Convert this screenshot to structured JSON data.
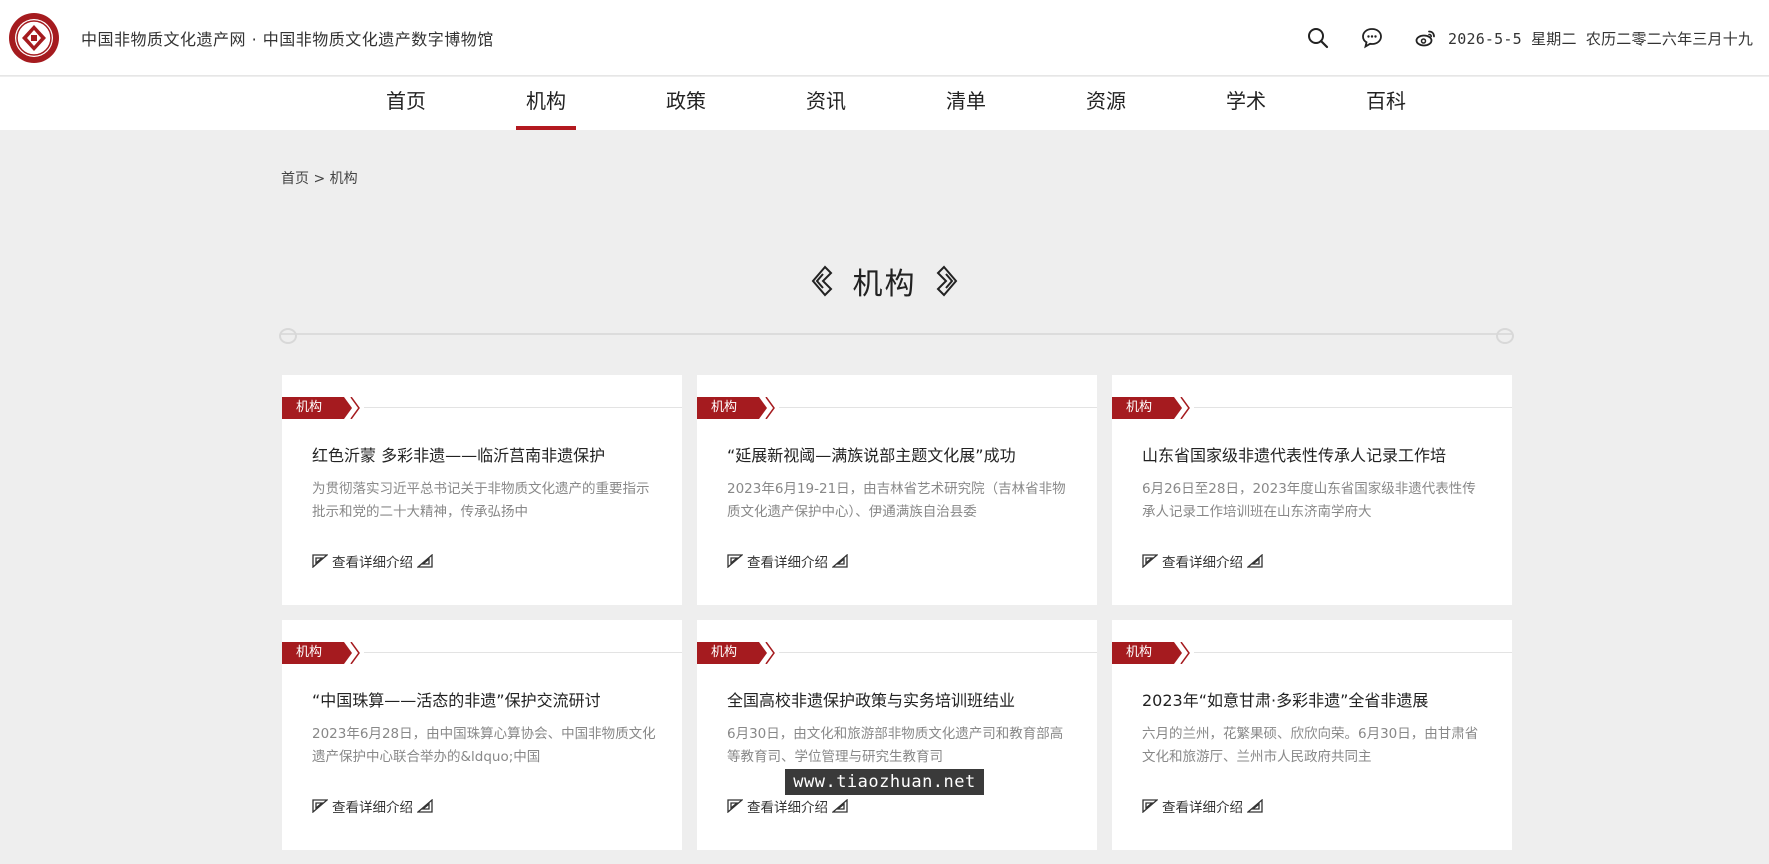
{
  "header": {
    "site_title": "中国非物质文化遗产网 · 中国非物质文化遗产数字博物馆",
    "date": "2026-5-5 星期二 农历二零二六年三月十九",
    "icons": [
      "search-icon",
      "chat-icon",
      "weibo-icon"
    ]
  },
  "nav": {
    "items": [
      "首页",
      "机构",
      "政策",
      "资讯",
      "清单",
      "资源",
      "学术",
      "百科"
    ],
    "active": "机构"
  },
  "breadcrumb": {
    "home": "首页",
    "sep": ">",
    "current": "机构"
  },
  "section": {
    "title": "机构"
  },
  "cards": [
    {
      "tag": "机构",
      "title": "红色沂蒙 多彩非遗——临沂莒南非遗保护",
      "desc": "为贯彻落实习近平总书记关于非物质文化遗产的重要指示批示和党的二十大精神，传承弘扬中",
      "more": "查看详细介绍"
    },
    {
      "tag": "机构",
      "title": "“延展新视阈—满族说部主题文化展”成功",
      "desc": "2023年6月19-21日，由吉林省艺术研究院（吉林省非物质文化遗产保护中心）、伊通满族自治县委",
      "more": "查看详细介绍"
    },
    {
      "tag": "机构",
      "title": "山东省国家级非遗代表性传承人记录工作培",
      "desc": "6月26日至28日，2023年度山东省国家级非遗代表性传承人记录工作培训班在山东济南学府大",
      "more": "查看详细介绍"
    },
    {
      "tag": "机构",
      "title": "“中国珠算——活态的非遗”保护交流研讨",
      "desc": "2023年6月28日，由中国珠算心算协会、中国非物质文化遗产保护中心联合举办的&ldquo;中国",
      "more": "查看详细介绍"
    },
    {
      "tag": "机构",
      "title": "全国高校非遗保护政策与实务培训班结业",
      "desc": "6月30日，由文化和旅游部非物质文化遗产司和教育部高等教育司、学位管理与研究生教育司",
      "more": "查看详细介绍"
    },
    {
      "tag": "机构",
      "title": "2023年“如意甘肃·多彩非遗”全省非遗展",
      "desc": "六月的兰州，花繁果硕、欣欣向荣。6月30日，由甘肃省文化和旅游厅、兰州市人民政府共同主",
      "more": "查看详细介绍"
    }
  ],
  "watermark": "www.tiaozhuan.net",
  "colors": {
    "accent": "#a51b1f",
    "background": "#eeeeee"
  }
}
